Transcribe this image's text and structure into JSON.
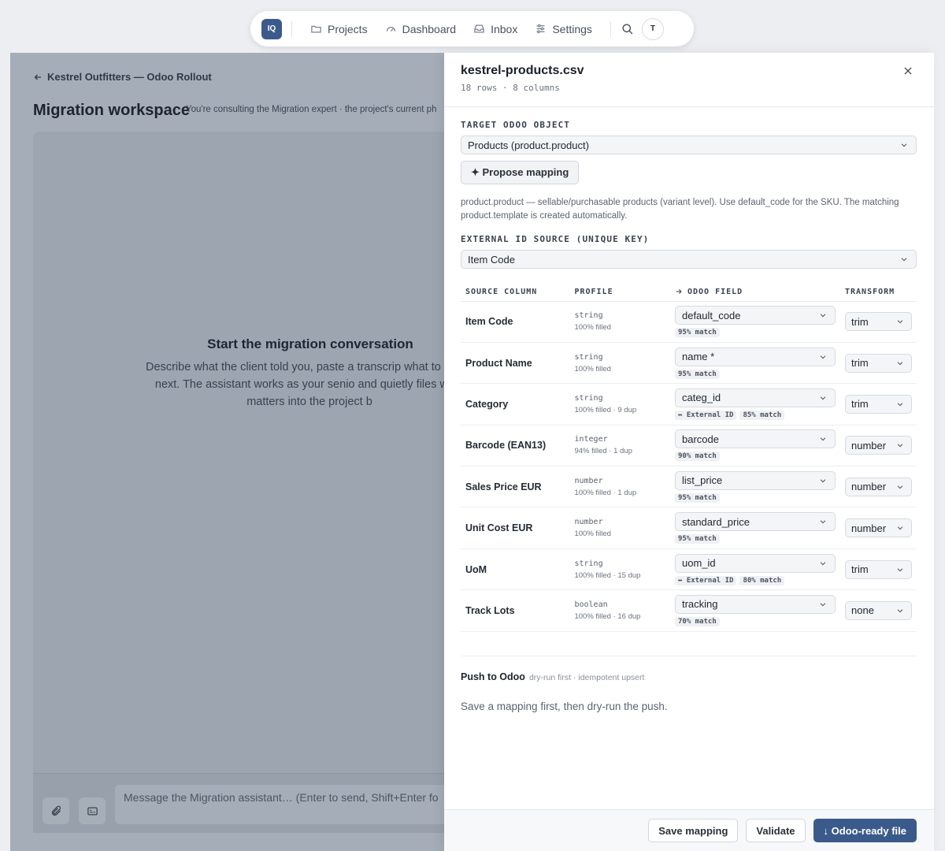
{
  "nav": {
    "logo": "IQ",
    "items": [
      {
        "label": "Projects",
        "icon": "folder-icon"
      },
      {
        "label": "Dashboard",
        "icon": "gauge-icon"
      },
      {
        "label": "Inbox",
        "icon": "inbox-icon"
      },
      {
        "label": "Settings",
        "icon": "sliders-icon"
      }
    ],
    "avatar": "T"
  },
  "workspace": {
    "breadcrumb": "Kestrel Outfitters — Odoo Rollout",
    "title": "Migration workspace",
    "subtitle": "You're consulting the Migration expert · the project's current ph",
    "empty_title": "Start the migration conversation",
    "empty_desc": "Describe what the client told you, paste a transcrip what to probe next. The assistant works as your senio and quietly files what matters into the project b",
    "composer_placeholder": "Message the Migration assistant…  (Enter to send, Shift+Enter fo"
  },
  "drawer": {
    "file_name": "kestrel-products.csv",
    "file_meta": "18 rows · 8 columns",
    "target_label": "TARGET ODOO OBJECT",
    "target_value": "Products (product.product)",
    "propose_button": "✦ Propose mapping",
    "target_desc": "product.product — sellable/purchasable products (variant level). Use default_code for the SKU. The matching product.template is created automatically.",
    "external_label": "EXTERNAL ID SOURCE (UNIQUE KEY)",
    "external_value": "Item Code",
    "headers": {
      "source": "SOURCE COLUMN",
      "profile": "PROFILE",
      "field": "ODOO FIELD",
      "transform": "TRANSFORM"
    },
    "rows": [
      {
        "source": "Item Code",
        "type": "string",
        "stats": "100% filled",
        "field": "default_code",
        "ext": "",
        "match": "95% match",
        "transform": "trim"
      },
      {
        "source": "Product Name",
        "type": "string",
        "stats": "100% filled",
        "field": "name *",
        "ext": "",
        "match": "95% match",
        "transform": "trim"
      },
      {
        "source": "Category",
        "type": "string",
        "stats": "100% filled · 9 dup",
        "field": "categ_id",
        "ext": "↔ External ID",
        "match": "85% match",
        "transform": "trim"
      },
      {
        "source": "Barcode (EAN13)",
        "type": "integer",
        "stats": "94% filled · 1 dup",
        "field": "barcode",
        "ext": "",
        "match": "90% match",
        "transform": "number"
      },
      {
        "source": "Sales Price EUR",
        "type": "number",
        "stats": "100% filled · 1 dup",
        "field": "list_price",
        "ext": "",
        "match": "95% match",
        "transform": "number"
      },
      {
        "source": "Unit Cost EUR",
        "type": "number",
        "stats": "100% filled",
        "field": "standard_price",
        "ext": "",
        "match": "95% match",
        "transform": "number"
      },
      {
        "source": "UoM",
        "type": "string",
        "stats": "100% filled · 15 dup",
        "field": "uom_id",
        "ext": "↔ External ID",
        "match": "80% match",
        "transform": "trim"
      },
      {
        "source": "Track Lots",
        "type": "boolean",
        "stats": "100% filled · 16 dup",
        "field": "tracking",
        "ext": "",
        "match": "70% match",
        "transform": "none"
      }
    ],
    "push_title": "Push to Odoo",
    "push_note": "dry-run first · idempotent upsert",
    "push_text": "Save a mapping first, then dry-run the push.",
    "footer": {
      "save": "Save mapping",
      "validate": "Validate",
      "export": "↓ Odoo-ready file"
    }
  }
}
